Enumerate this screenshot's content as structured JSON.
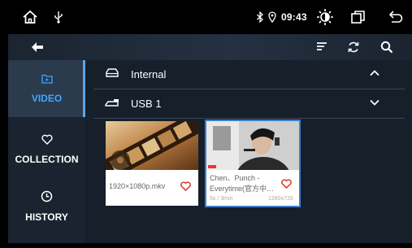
{
  "status_bar": {
    "time": "09:43",
    "icons": [
      "home-icon",
      "usb-icon",
      "bluetooth-icon",
      "location-icon",
      "brightness-icon",
      "window-icon",
      "return-icon"
    ]
  },
  "toolbar": {
    "icons": [
      "back-icon",
      "sort-icon",
      "refresh-icon",
      "search-icon"
    ]
  },
  "sidebar": {
    "items": [
      {
        "label": "VIDEO",
        "icon": "video-folder-icon",
        "active": true
      },
      {
        "label": "COLLECTION",
        "icon": "heart-outline-icon",
        "active": false
      },
      {
        "label": "HISTORY",
        "icon": "clock-icon",
        "active": false
      }
    ]
  },
  "storage": [
    {
      "name": "Internal",
      "icon": "drive-icon",
      "expanded": true
    },
    {
      "name": "USB 1",
      "icon": "usb-drive-icon",
      "expanded": false
    }
  ],
  "videos": [
    {
      "title": "1920×1080p.mkv",
      "favorite": true
    },
    {
      "title_line1": "Chen、Punch -",
      "title_line2": "Everytime(官方中…",
      "duration": "5s / 3min",
      "resolution": "1280x720",
      "favorite": true,
      "selected": true
    }
  ],
  "colors": {
    "accent": "#42a5ff",
    "heart": "#e0413d",
    "background": "#161f2a"
  }
}
